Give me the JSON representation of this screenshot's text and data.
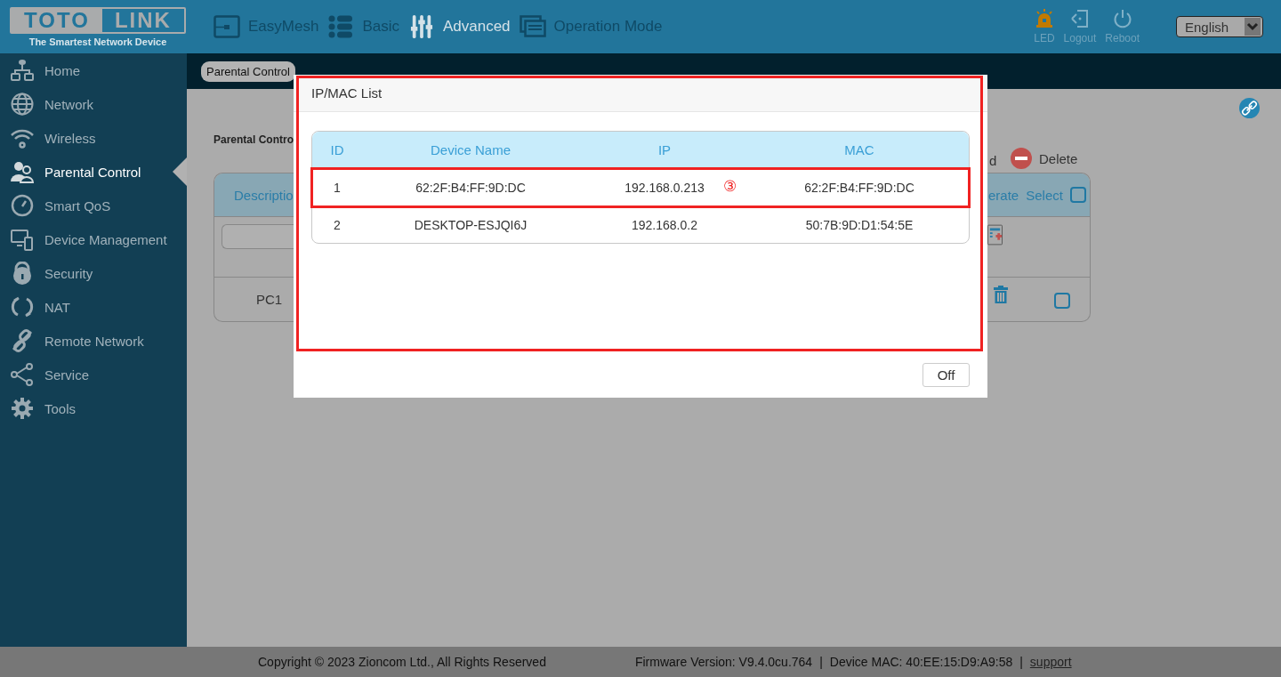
{
  "header": {
    "logo": {
      "left": "TOTO",
      "right": "LINK",
      "tagline": "The Smartest Network Device"
    },
    "nav": [
      {
        "label": "EasyMesh",
        "selected": false
      },
      {
        "label": "Basic",
        "selected": false
      },
      {
        "label": "Advanced",
        "selected": true
      },
      {
        "label": "Operation Mode",
        "selected": false
      }
    ],
    "actions": [
      {
        "label": "LED",
        "kind": "led"
      },
      {
        "label": "Logout",
        "kind": "logout"
      },
      {
        "label": "Reboot",
        "kind": "reboot"
      }
    ],
    "language": {
      "value": "English"
    }
  },
  "sidebar": {
    "items": [
      {
        "label": "Home",
        "selected": false
      },
      {
        "label": "Network",
        "selected": false
      },
      {
        "label": "Wireless",
        "selected": false
      },
      {
        "label": "Parental Control",
        "selected": true
      },
      {
        "label": "Smart QoS",
        "selected": false
      },
      {
        "label": "Device Management",
        "selected": false
      },
      {
        "label": "Security",
        "selected": false
      },
      {
        "label": "NAT",
        "selected": false
      },
      {
        "label": "Remote Network",
        "selected": false
      },
      {
        "label": "Service",
        "selected": false
      },
      {
        "label": "Tools",
        "selected": false
      }
    ]
  },
  "breadcrumb": "Parental Control",
  "page": {
    "section_title": "Parental Contro",
    "toolbar": {
      "add_fragment": "d",
      "delete": "Delete"
    },
    "table": {
      "column_1": "Descriptio",
      "column_operate": "erate",
      "column_select": "Select",
      "select_all_checked": false,
      "rows": [
        {
          "description": "PC1",
          "checked": false
        }
      ]
    }
  },
  "modal": {
    "title": "IP/MAC List",
    "columns": [
      "ID",
      "Device Name",
      "IP",
      "MAC"
    ],
    "rows": [
      {
        "id": "1",
        "device_name": "62:2F:B4:FF:9D:DC",
        "ip": "192.168.0.213",
        "mac": "62:2F:B4:FF:9D:DC",
        "annotated": true
      },
      {
        "id": "2",
        "device_name": "DESKTOP-ESJQI6J",
        "ip": "192.168.0.2",
        "mac": "50:7B:9D:D1:54:5E",
        "annotated": false
      }
    ],
    "annotation_mark": "③",
    "button": "Off"
  },
  "footer": {
    "copyright": "Copyright © 2023 Zioncom Ltd., All Rights Reserved",
    "firmware": "Firmware Version: V9.4.0cu.764",
    "separator_1": "|",
    "device_mac": "Device MAC: 40:EE:15:D9:A9:58",
    "separator_2": "|",
    "link": "support"
  }
}
